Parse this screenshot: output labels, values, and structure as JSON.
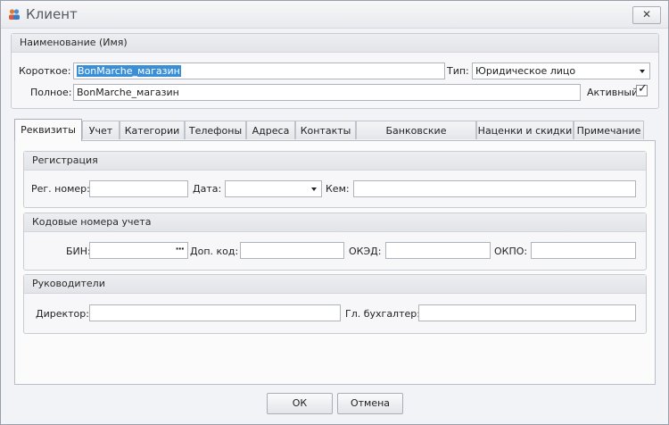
{
  "window": {
    "title": "Клиент",
    "close_label": "✕"
  },
  "name_group": {
    "header": "Наименование (Имя)",
    "short_label": "Короткое:",
    "short_value": "BonMarche_магазин",
    "type_label": "Тип:",
    "type_value": "Юридическое лицо",
    "full_label": "Полное:",
    "full_value": "BonMarche_магазин",
    "active_label": "Активный",
    "active_checked": true
  },
  "tabs": [
    {
      "label": "Реквизиты",
      "active": true
    },
    {
      "label": "Учет"
    },
    {
      "label": "Категории"
    },
    {
      "label": "Телефоны"
    },
    {
      "label": "Адреса"
    },
    {
      "label": "Контакты"
    },
    {
      "label": "Банковские реквизиты"
    },
    {
      "label": "Наценки и скидки"
    },
    {
      "label": "Примечание"
    }
  ],
  "registration": {
    "header": "Регистрация",
    "reg_number_label": "Рег. номер:",
    "reg_number_value": "",
    "date_label": "Дата:",
    "date_value": "",
    "issued_by_label": "Кем:",
    "issued_by_value": ""
  },
  "account_codes": {
    "header": "Кодовые номера учета",
    "bin_label": "БИН:",
    "bin_value": "",
    "bin_ellipsis": "···",
    "extra_code_label": "Доп. код:",
    "extra_code_value": "",
    "oked_label": "ОКЭД:",
    "oked_value": "",
    "okpo_label": "ОКПО:",
    "okpo_value": ""
  },
  "managers": {
    "header": "Руководители",
    "director_label": "Директор:",
    "director_value": "",
    "chief_accountant_label": "Гл. бухгалтер:",
    "chief_accountant_value": ""
  },
  "footer": {
    "ok_label": "ОК",
    "cancel_label": "Отмена"
  }
}
